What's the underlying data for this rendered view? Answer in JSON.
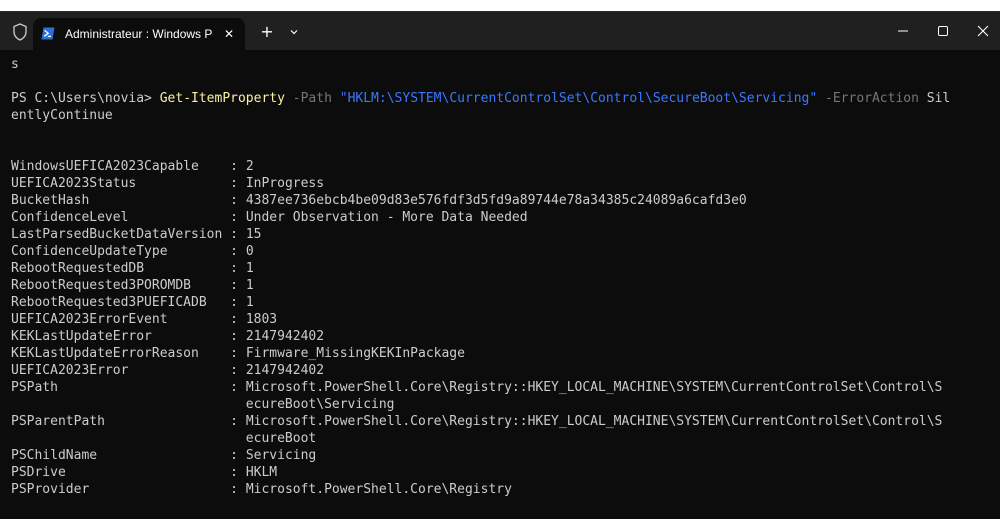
{
  "window": {
    "tab_title": "Administrateur : Windows PowerShell",
    "new_tab_symbol": "+",
    "close_tab_symbol": "✕"
  },
  "terminal": {
    "previous_output": "s",
    "prompt": "PS C:\\Users\\novia> ",
    "command": {
      "cmdlet": "Get-ItemProperty",
      "param_path": "-Path",
      "path_value": "\"HKLM:\\SYSTEM\\CurrentControlSet\\Control\\SecureBoot\\Servicing\"",
      "param_erroraction": "-ErrorAction",
      "erroraction_value_part1": "Sil",
      "erroraction_value_part2": "entlyContinue"
    },
    "properties": [
      {
        "name": "WindowsUEFICA2023Capable",
        "value": "2"
      },
      {
        "name": "UEFICA2023Status",
        "value": "InProgress"
      },
      {
        "name": "BucketHash",
        "value": "4387ee736ebcb4be09d83e576fdf3d5fd9a89744e78a34385c24089a6cafd3e0"
      },
      {
        "name": "ConfidenceLevel",
        "value": "Under Observation - More Data Needed"
      },
      {
        "name": "LastParsedBucketDataVersion",
        "value": "15"
      },
      {
        "name": "ConfidenceUpdateType",
        "value": "0"
      },
      {
        "name": "RebootRequestedDB",
        "value": "1"
      },
      {
        "name": "RebootRequested3POROMDB",
        "value": "1"
      },
      {
        "name": "RebootRequested3PUEFICADB",
        "value": "1"
      },
      {
        "name": "UEFICA2023ErrorEvent",
        "value": "1803"
      },
      {
        "name": "KEKLastUpdateError",
        "value": "2147942402"
      },
      {
        "name": "KEKLastUpdateErrorReason",
        "value": "Firmware_MissingKEKInPackage"
      },
      {
        "name": "UEFICA2023Error",
        "value": "2147942402"
      },
      {
        "name": "PSPath",
        "value": "Microsoft.PowerShell.Core\\Registry::HKEY_LOCAL_MACHINE\\SYSTEM\\CurrentControlSet\\Control\\S",
        "continuation": "ecureBoot\\Servicing"
      },
      {
        "name": "PSParentPath",
        "value": "Microsoft.PowerShell.Core\\Registry::HKEY_LOCAL_MACHINE\\SYSTEM\\CurrentControlSet\\Control\\S",
        "continuation": "ecureBoot"
      },
      {
        "name": "PSChildName",
        "value": "Servicing"
      },
      {
        "name": "PSDrive",
        "value": "HKLM"
      },
      {
        "name": "PSProvider",
        "value": "Microsoft.PowerShell.Core\\Registry"
      }
    ]
  },
  "colors": {
    "background": "#0c0c0c",
    "titlebar": "#202020",
    "text": "#cccccc",
    "cmdlet": "#f9f1a5",
    "parameter": "#767676",
    "string": "#3b78ff"
  },
  "icons": {
    "shield": "shield-icon",
    "powershell": "powershell-icon",
    "dropdown": "chevron-down-icon",
    "minimize": "minimize-icon",
    "maximize": "maximize-icon",
    "close": "close-icon"
  }
}
